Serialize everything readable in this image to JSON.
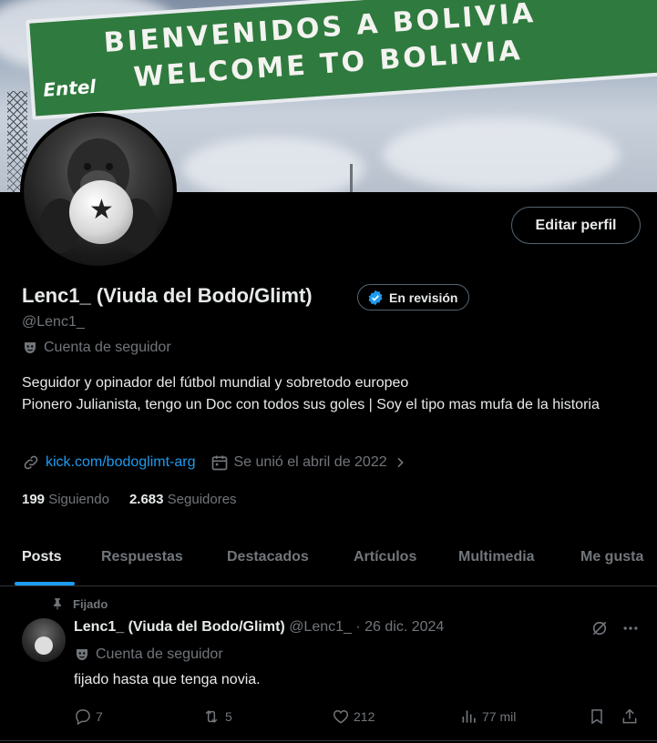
{
  "banner": {
    "line1": "BIENVENIDOS A BOLIVIA",
    "line2": "WELCOME TO BOLIVIA",
    "brand": "Entel"
  },
  "profile": {
    "edit_label": "Editar perfil",
    "name": "Lenc1_ (Viuda del Bodo/Glimt)",
    "verify_label": "En revisión",
    "handle": "@Lenc1_",
    "account_type": "Cuenta de seguidor",
    "bio_line1": "Seguidor y opinador del fútbol mundial y sobretodo europeo",
    "bio_line2": "Pionero Julianista, tengo un Doc con todos sus goles | Soy el tipo mas mufa de la historia",
    "link": "kick.com/bodoglimt-arg",
    "joined": "Se unió el abril de 2022",
    "following_count": "199",
    "following_label": "Siguiendo",
    "followers_count": "2.683",
    "followers_label": "Seguidores"
  },
  "tabs": [
    {
      "label": "Posts"
    },
    {
      "label": "Respuestas"
    },
    {
      "label": "Destacados"
    },
    {
      "label": "Artículos"
    },
    {
      "label": "Multimedia"
    },
    {
      "label": "Me gusta"
    }
  ],
  "post": {
    "pinned_label": "Fijado",
    "author_name": "Lenc1_ (Viuda del Bodo/Glimt)",
    "meta": "@Lenc1_ · 26 dic. 2024",
    "account_type": "Cuenta de seguidor",
    "text": "fijado hasta que tenga novia.",
    "replies": "7",
    "reposts": "5",
    "likes": "212",
    "views": "77 mil"
  },
  "colors": {
    "accent": "#1d9bf0",
    "muted": "#71767b",
    "text": "#e7e9ea",
    "border": "#2f3336"
  }
}
